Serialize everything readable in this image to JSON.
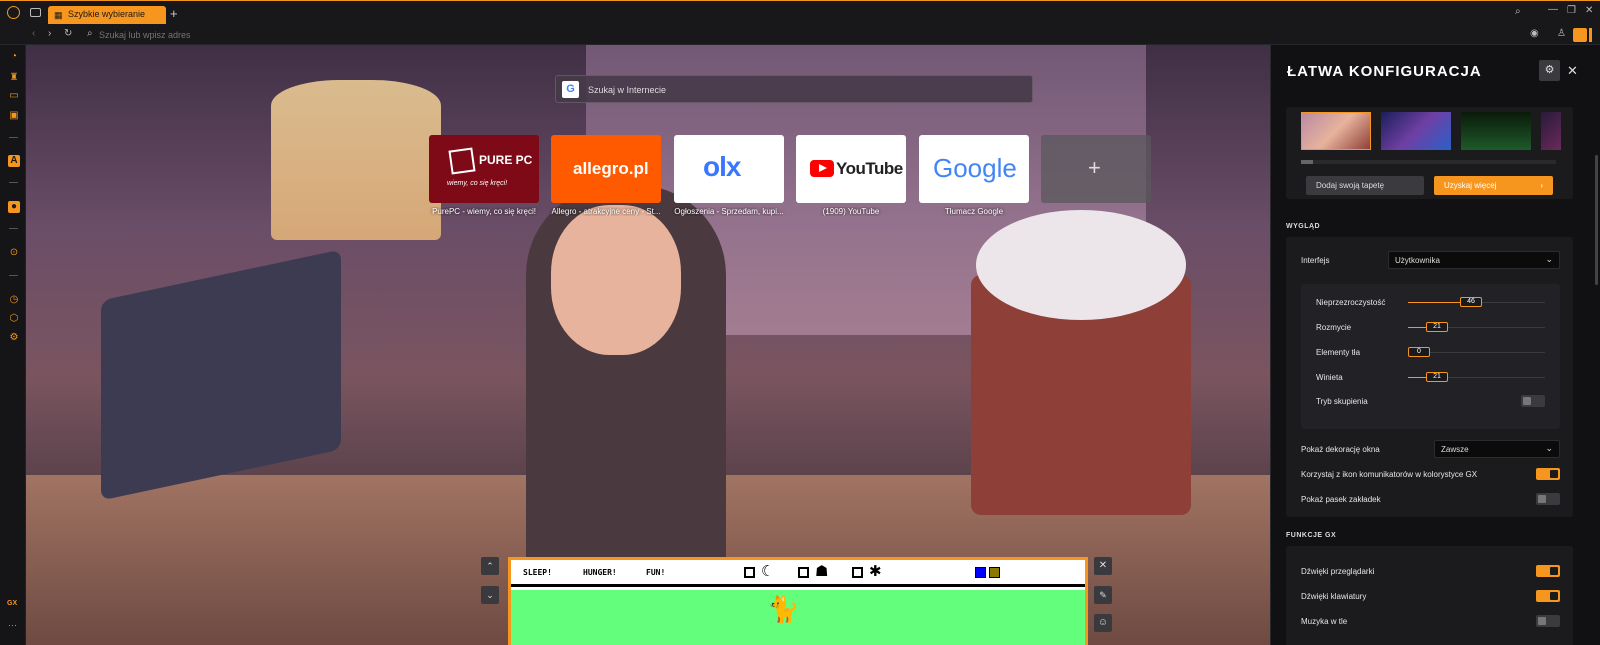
{
  "browser": {
    "tab_title": "Szybkie wybieranie",
    "address_placeholder": "Szukaj lub wpisz adres",
    "sidebar_bottom_label": "GX",
    "colors": {
      "accent": "#f6961e",
      "chrome": "#18181b"
    }
  },
  "search": {
    "placeholder": "Szukaj w Internecie"
  },
  "speed_dial": [
    {
      "label": "PurePC - wiemy, co się kręci!",
      "logo": "PURE PC",
      "tagline": "wiemy, co się kręci!"
    },
    {
      "label": "Allegro - atrakcyjne ceny - St...",
      "logo": "allegro.pl"
    },
    {
      "label": "Ogłoszenia - Sprzedam, kupi...",
      "logo": "olx"
    },
    {
      "label": "(1909) YouTube",
      "logo": "YouTube"
    },
    {
      "label": "Tłumacz Google",
      "logo": "Google"
    }
  ],
  "game": {
    "stats": [
      "SLEEP!",
      "HUNGER!",
      "FUN!"
    ]
  },
  "panel": {
    "title": "ŁATWA KONFIGURACJA",
    "add_wallpaper": "Dodaj swoją tapetę",
    "get_more": "Uzyskaj więcej",
    "section_appearance": "WYGLĄD",
    "interface_label": "Interfejs",
    "interface_value": "Użytkownika",
    "sliders": [
      {
        "label": "Nieprzezroczystość",
        "value": 46,
        "max": 100
      },
      {
        "label": "Rozmycie",
        "value": 21,
        "max": 100
      },
      {
        "label": "Elementy tła",
        "value": 0,
        "max": 100
      },
      {
        "label": "Winieta",
        "value": 21,
        "max": 100
      }
    ],
    "focus_mode": "Tryb skupienia",
    "focus_mode_on": false,
    "window_decor_label": "Pokaż dekorację okna",
    "window_decor_value": "Zawsze",
    "messenger_icons_label": "Korzystaj z ikon komunikatorów w kolorystyce GX",
    "messenger_icons_on": true,
    "bookmarks_bar_label": "Pokaż pasek zakładek",
    "bookmarks_bar_on": false,
    "section_gx": "FUNKCJE GX",
    "browser_sounds_label": "Dźwięki przeglądarki",
    "browser_sounds_on": true,
    "keyboard_sounds_label": "Dźwięki klawiatury",
    "keyboard_sounds_on": true,
    "bg_music_label": "Muzyka w tle",
    "bg_music_on": false
  }
}
